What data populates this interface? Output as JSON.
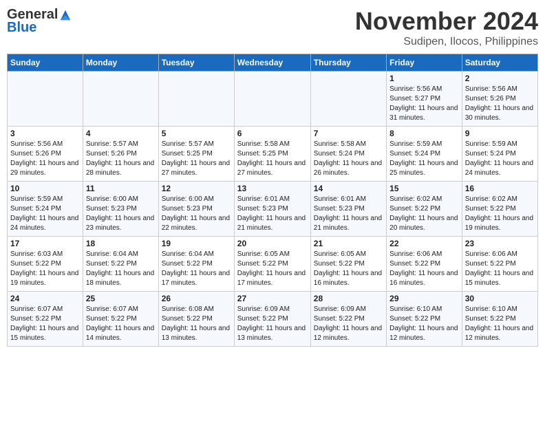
{
  "header": {
    "logo_general": "General",
    "logo_blue": "Blue",
    "month": "November 2024",
    "location": "Sudipen, Ilocos, Philippines"
  },
  "weekdays": [
    "Sunday",
    "Monday",
    "Tuesday",
    "Wednesday",
    "Thursday",
    "Friday",
    "Saturday"
  ],
  "weeks": [
    [
      {
        "day": "",
        "info": ""
      },
      {
        "day": "",
        "info": ""
      },
      {
        "day": "",
        "info": ""
      },
      {
        "day": "",
        "info": ""
      },
      {
        "day": "",
        "info": ""
      },
      {
        "day": "1",
        "info": "Sunrise: 5:56 AM\nSunset: 5:27 PM\nDaylight: 11 hours and 31 minutes."
      },
      {
        "day": "2",
        "info": "Sunrise: 5:56 AM\nSunset: 5:26 PM\nDaylight: 11 hours and 30 minutes."
      }
    ],
    [
      {
        "day": "3",
        "info": "Sunrise: 5:56 AM\nSunset: 5:26 PM\nDaylight: 11 hours and 29 minutes."
      },
      {
        "day": "4",
        "info": "Sunrise: 5:57 AM\nSunset: 5:26 PM\nDaylight: 11 hours and 28 minutes."
      },
      {
        "day": "5",
        "info": "Sunrise: 5:57 AM\nSunset: 5:25 PM\nDaylight: 11 hours and 27 minutes."
      },
      {
        "day": "6",
        "info": "Sunrise: 5:58 AM\nSunset: 5:25 PM\nDaylight: 11 hours and 27 minutes."
      },
      {
        "day": "7",
        "info": "Sunrise: 5:58 AM\nSunset: 5:24 PM\nDaylight: 11 hours and 26 minutes."
      },
      {
        "day": "8",
        "info": "Sunrise: 5:59 AM\nSunset: 5:24 PM\nDaylight: 11 hours and 25 minutes."
      },
      {
        "day": "9",
        "info": "Sunrise: 5:59 AM\nSunset: 5:24 PM\nDaylight: 11 hours and 24 minutes."
      }
    ],
    [
      {
        "day": "10",
        "info": "Sunrise: 5:59 AM\nSunset: 5:24 PM\nDaylight: 11 hours and 24 minutes."
      },
      {
        "day": "11",
        "info": "Sunrise: 6:00 AM\nSunset: 5:23 PM\nDaylight: 11 hours and 23 minutes."
      },
      {
        "day": "12",
        "info": "Sunrise: 6:00 AM\nSunset: 5:23 PM\nDaylight: 11 hours and 22 minutes."
      },
      {
        "day": "13",
        "info": "Sunrise: 6:01 AM\nSunset: 5:23 PM\nDaylight: 11 hours and 21 minutes."
      },
      {
        "day": "14",
        "info": "Sunrise: 6:01 AM\nSunset: 5:23 PM\nDaylight: 11 hours and 21 minutes."
      },
      {
        "day": "15",
        "info": "Sunrise: 6:02 AM\nSunset: 5:22 PM\nDaylight: 11 hours and 20 minutes."
      },
      {
        "day": "16",
        "info": "Sunrise: 6:02 AM\nSunset: 5:22 PM\nDaylight: 11 hours and 19 minutes."
      }
    ],
    [
      {
        "day": "17",
        "info": "Sunrise: 6:03 AM\nSunset: 5:22 PM\nDaylight: 11 hours and 19 minutes."
      },
      {
        "day": "18",
        "info": "Sunrise: 6:04 AM\nSunset: 5:22 PM\nDaylight: 11 hours and 18 minutes."
      },
      {
        "day": "19",
        "info": "Sunrise: 6:04 AM\nSunset: 5:22 PM\nDaylight: 11 hours and 17 minutes."
      },
      {
        "day": "20",
        "info": "Sunrise: 6:05 AM\nSunset: 5:22 PM\nDaylight: 11 hours and 17 minutes."
      },
      {
        "day": "21",
        "info": "Sunrise: 6:05 AM\nSunset: 5:22 PM\nDaylight: 11 hours and 16 minutes."
      },
      {
        "day": "22",
        "info": "Sunrise: 6:06 AM\nSunset: 5:22 PM\nDaylight: 11 hours and 16 minutes."
      },
      {
        "day": "23",
        "info": "Sunrise: 6:06 AM\nSunset: 5:22 PM\nDaylight: 11 hours and 15 minutes."
      }
    ],
    [
      {
        "day": "24",
        "info": "Sunrise: 6:07 AM\nSunset: 5:22 PM\nDaylight: 11 hours and 15 minutes."
      },
      {
        "day": "25",
        "info": "Sunrise: 6:07 AM\nSunset: 5:22 PM\nDaylight: 11 hours and 14 minutes."
      },
      {
        "day": "26",
        "info": "Sunrise: 6:08 AM\nSunset: 5:22 PM\nDaylight: 11 hours and 13 minutes."
      },
      {
        "day": "27",
        "info": "Sunrise: 6:09 AM\nSunset: 5:22 PM\nDaylight: 11 hours and 13 minutes."
      },
      {
        "day": "28",
        "info": "Sunrise: 6:09 AM\nSunset: 5:22 PM\nDaylight: 11 hours and 12 minutes."
      },
      {
        "day": "29",
        "info": "Sunrise: 6:10 AM\nSunset: 5:22 PM\nDaylight: 11 hours and 12 minutes."
      },
      {
        "day": "30",
        "info": "Sunrise: 6:10 AM\nSunset: 5:22 PM\nDaylight: 11 hours and 12 minutes."
      }
    ]
  ]
}
